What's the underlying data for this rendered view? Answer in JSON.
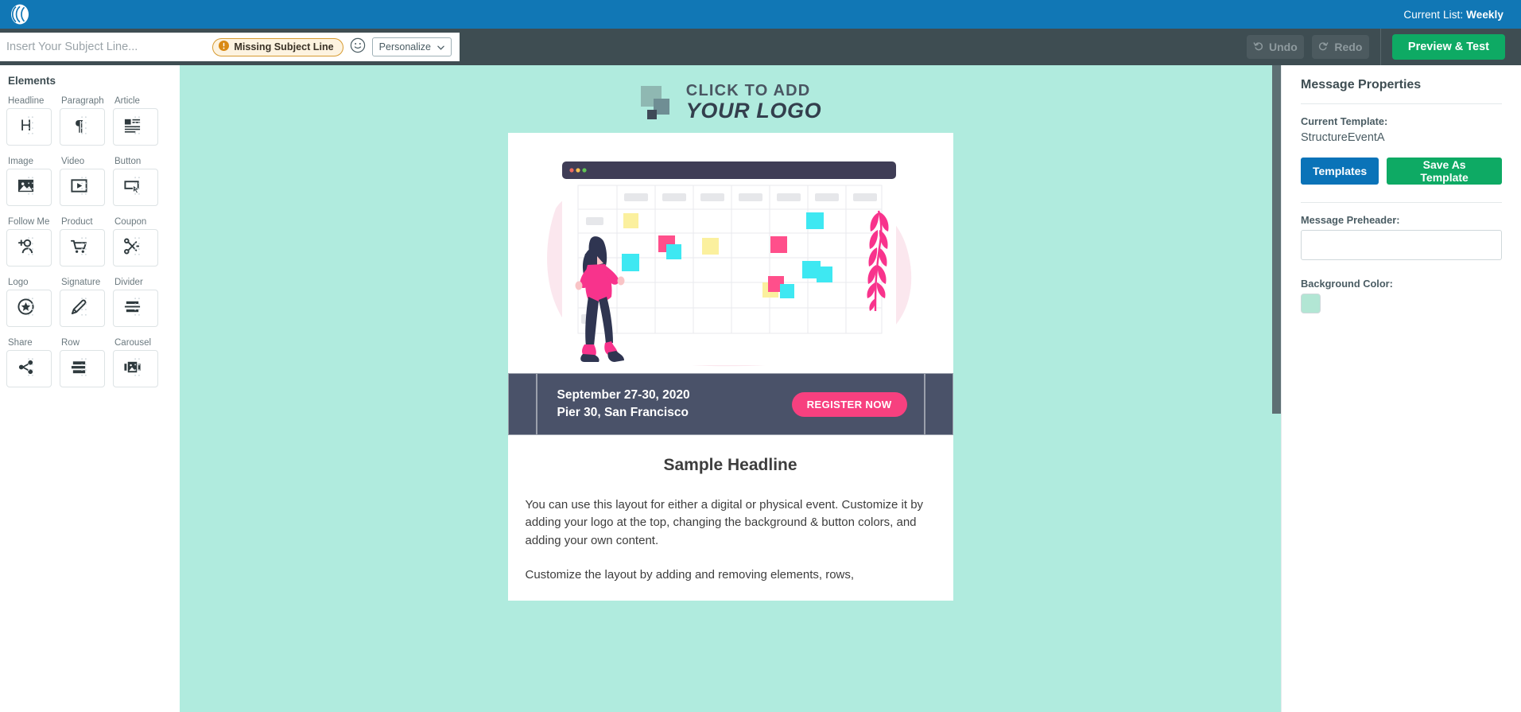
{
  "topbar": {
    "logo_icon": "app-logo-icon",
    "current_list_label": "Current List:",
    "current_list_value": "Weekly"
  },
  "toolbar": {
    "subject_placeholder": "Insert Your Subject Line...",
    "subject_value": "",
    "missing_subject_badge": "Missing Subject Line",
    "warn_icon": "alert-circle-icon",
    "emoji_icon": "emoji-smiley-icon",
    "personalize_label": "Personalize",
    "chevron_icon": "chevron-down-icon",
    "undo_label": "Undo",
    "undo_icon": "undo-arrow-icon",
    "redo_label": "Redo",
    "redo_icon": "redo-arrow-icon",
    "preview_label": "Preview & Test"
  },
  "elements": {
    "title": "Elements",
    "items": [
      {
        "label": "Headline",
        "icon": "headline-h-icon"
      },
      {
        "label": "Paragraph",
        "icon": "paragraph-pilcrow-icon"
      },
      {
        "label": "Article",
        "icon": "article-icon"
      },
      {
        "label": "Image",
        "icon": "image-icon"
      },
      {
        "label": "Video",
        "icon": "video-play-icon"
      },
      {
        "label": "Button",
        "icon": "button-cursor-icon"
      },
      {
        "label": "Follow Me",
        "icon": "follow-me-person-plus-icon"
      },
      {
        "label": "Product",
        "icon": "product-cart-icon"
      },
      {
        "label": "Coupon",
        "icon": "coupon-scissors-icon"
      },
      {
        "label": "Logo",
        "icon": "logo-star-circle-icon"
      },
      {
        "label": "Signature",
        "icon": "signature-pen-icon"
      },
      {
        "label": "Divider",
        "icon": "divider-icon"
      },
      {
        "label": "Share",
        "icon": "share-nodes-icon"
      },
      {
        "label": "Row",
        "icon": "row-layout-icon"
      },
      {
        "label": "Carousel",
        "icon": "carousel-image-icon"
      }
    ]
  },
  "canvas": {
    "background_color": "#b0ebde",
    "logo_placeholder": {
      "line1": "CLICK TO ADD",
      "line2": "YOUR LOGO"
    },
    "hero": {
      "alt": "woman placing sticky notes on a calendar planner window",
      "blob_color": "#fbe3ec",
      "window_bar_color": "#3f3d56",
      "sticky_colors": [
        "#ff4f8b",
        "#3ee8f2",
        "#fbf09e"
      ]
    },
    "event_banner": {
      "background_color": "#4a5269",
      "date_line1": "September 27-30, 2020",
      "date_line2": "Pier 30, San Francisco",
      "cta_label": "REGISTER NOW",
      "cta_color": "#f7407f"
    },
    "content": {
      "headline": "Sample Headline",
      "paragraph1": "You can use this layout for either a digital or physical event. Customize it by adding your logo at the top, changing the background & button colors, and adding your own content.",
      "paragraph2": "Customize the layout by adding and removing elements, rows,"
    }
  },
  "properties": {
    "title": "Message Properties",
    "current_template_label": "Current Template:",
    "current_template_value": "StructureEventA",
    "templates_button": "Templates",
    "save_as_template_button": "Save As Template",
    "preheader_label": "Message Preheader:",
    "preheader_value": "",
    "background_color_label": "Background Color:",
    "background_color_value": "#b2e6d4"
  }
}
